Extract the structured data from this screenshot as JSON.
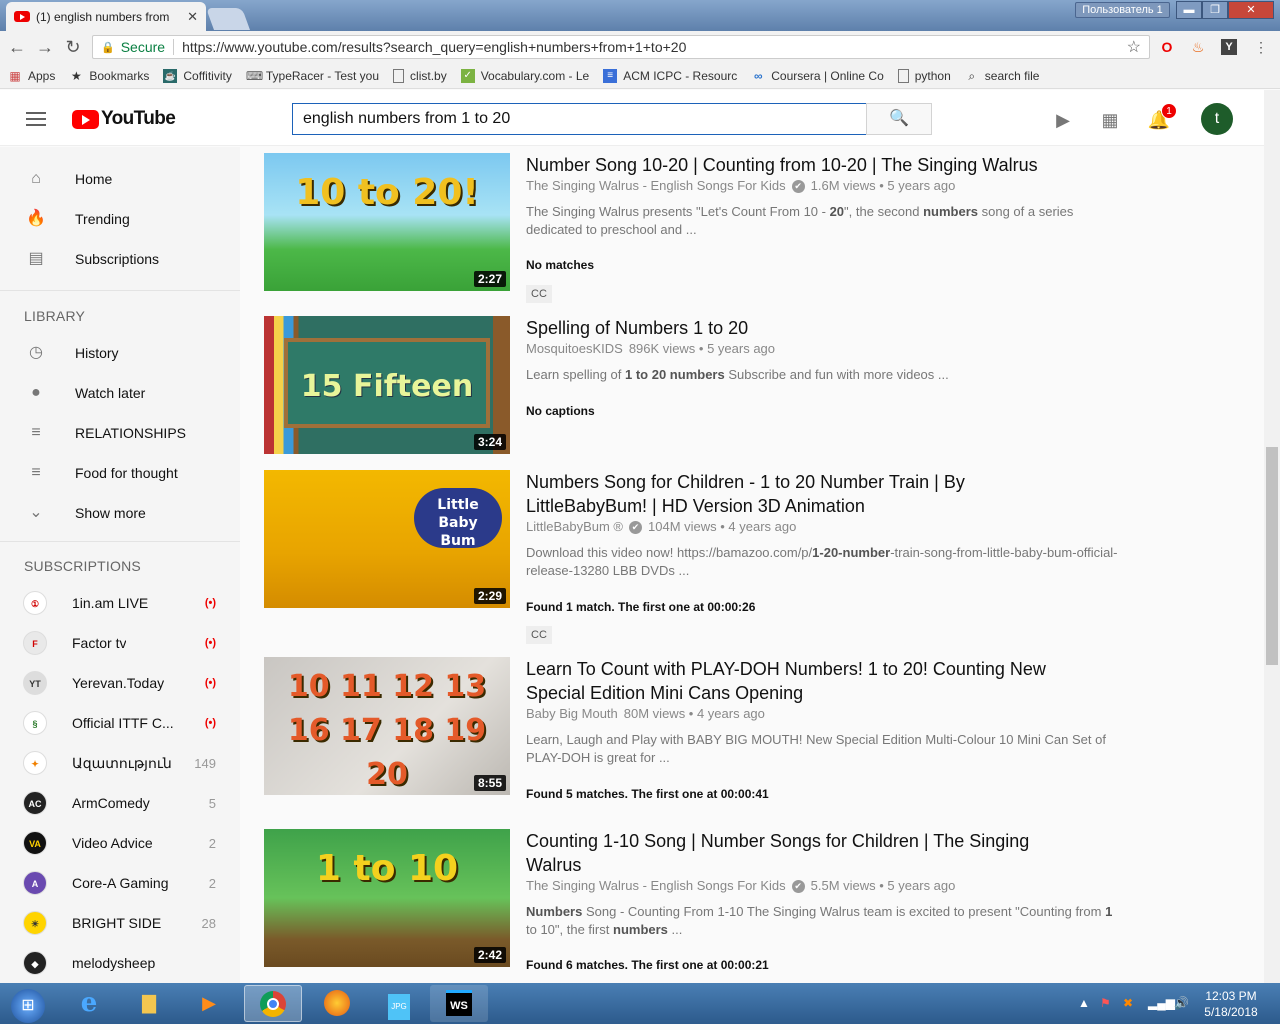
{
  "browser": {
    "tab_title": "(1) english numbers from",
    "tab_close": "✕",
    "user_chip": "Пользователь 1",
    "min": "▬",
    "max": "❐",
    "close": "✕",
    "secure_label": "Secure",
    "url": "https://www.youtube.com/results?search_query=english+numbers+from+1+to+20",
    "bookmarks": [
      {
        "label": "Apps",
        "icon": "apps-grid-icon"
      },
      {
        "label": "Bookmarks",
        "icon": "star-icon"
      },
      {
        "label": "Coffitivity",
        "icon": "coffee-icon"
      },
      {
        "label": "TypeRacer - Test you",
        "icon": "typeracer-icon"
      },
      {
        "label": "clist.by",
        "icon": "page-icon"
      },
      {
        "label": "Vocabulary.com - Le",
        "icon": "check-icon"
      },
      {
        "label": "ACM ICPC - Resourc",
        "icon": "doc-icon"
      },
      {
        "label": "Coursera | Online Co",
        "icon": "coursera-icon"
      },
      {
        "label": "python",
        "icon": "page-icon"
      },
      {
        "label": "search file",
        "icon": "search-file-icon"
      }
    ]
  },
  "youtube": {
    "logo_text": "YouTube",
    "search_value": "english numbers from 1 to 20",
    "notification_count": "1",
    "avatar_letter": "t"
  },
  "sidebar": {
    "main": [
      {
        "label": "Home",
        "icon": "home-icon"
      },
      {
        "label": "Trending",
        "icon": "flame-icon"
      },
      {
        "label": "Subscriptions",
        "icon": "subscriptions-icon"
      }
    ],
    "library_heading": "LIBRARY",
    "library": [
      {
        "label": "History",
        "icon": "history-icon"
      },
      {
        "label": "Watch later",
        "icon": "clock-icon"
      },
      {
        "label": "RELATIONSHIPS",
        "icon": "playlist-icon"
      },
      {
        "label": "Food for thought",
        "icon": "playlist-icon"
      },
      {
        "label": "Show more",
        "icon": "chevron-down-icon"
      }
    ],
    "subscriptions_heading": "SUBSCRIPTIONS",
    "subscriptions": [
      {
        "name": "1in.am LIVE",
        "badge": "(•)",
        "color": "#ffffff",
        "fg": "#d00000",
        "mono": "①"
      },
      {
        "name": "Factor tv",
        "badge": "(•)",
        "color": "#e9e9e9",
        "fg": "#d00000",
        "mono": "F"
      },
      {
        "name": "Yerevan.Today",
        "badge": "(•)",
        "color": "#dddddd",
        "fg": "#333333",
        "mono": "YT"
      },
      {
        "name": "Official ITTF C...",
        "badge": "(•)",
        "color": "#ffffff",
        "fg": "#2a7a2a",
        "mono": "§"
      },
      {
        "name": "Ազատություն",
        "badge": "149",
        "color": "#ffffff",
        "fg": "#f08000",
        "mono": "✦"
      },
      {
        "name": "ArmComedy",
        "badge": "5",
        "color": "#222222",
        "fg": "#ffffff",
        "mono": "AC"
      },
      {
        "name": "Video Advice",
        "badge": "2",
        "color": "#111111",
        "fg": "#ffd000",
        "mono": "VA"
      },
      {
        "name": "Core-A Gaming",
        "badge": "2",
        "color": "#6a4ab0",
        "fg": "#ffffff",
        "mono": "A"
      },
      {
        "name": "BRIGHT SIDE",
        "badge": "28",
        "color": "#ffd400",
        "fg": "#333333",
        "mono": "☀"
      },
      {
        "name": "melodysheep",
        "badge": "",
        "color": "#222222",
        "fg": "#ffffff",
        "mono": "◆"
      }
    ]
  },
  "results": [
    {
      "title": "Number Song 10-20 | Counting from 10-20 | The Singing Walrus",
      "channel": "The Singing Walrus - English Songs For Kids",
      "verified": "✔",
      "meta": "1.6M views • 5 years ago",
      "desc_parts": [
        "The Singing Walrus presents \"Let's Count From 10 - ",
        "20",
        "\", the second ",
        "numbers",
        " song of a series dedicated to preschool and ..."
      ],
      "match": "No matches",
      "cc": "CC",
      "duration": "2:27",
      "thumb_text": "10 to 20!"
    },
    {
      "title": "Spelling of Numbers 1 to 20",
      "channel": "MosquitoesKIDS",
      "verified": "",
      "meta": "896K views • 5 years ago",
      "desc_parts": [
        "Learn spelling of ",
        "1 to 20 numbers",
        " Subscribe and fun with more videos ..."
      ],
      "match": "No captions",
      "cc": "",
      "duration": "3:24",
      "thumb_text": "15 Fifteen"
    },
    {
      "title": "Numbers Song for Children - 1 to 20 Number Train | By LittleBabyBum! | HD Version 3D Animation",
      "channel": "LittleBabyBum ®",
      "verified": "✔",
      "meta": "104M views • 4 years ago",
      "desc_parts": [
        "Download this video now! https://bamazoo.com/p/",
        "1-20-number",
        "-train-song-from-little-baby-bum-official-release-13280 LBB DVDs ..."
      ],
      "match": "Found 1 match. The first one at 00:00:26",
      "cc": "CC",
      "duration": "2:29",
      "thumb_text": "Little Baby Bum"
    },
    {
      "title": "Learn To Count with PLAY-DOH Numbers! 1 to 20! Counting New Special Edition Mini Cans Opening",
      "channel": "Baby Big Mouth",
      "verified": "",
      "meta": "80M views • 4 years ago",
      "desc_parts": [
        "Learn, Laugh and Play with BABY BIG MOUTH! New Special Edition Multi-Colour 10 Mini Can Set of PLAY-DOH is great for ..."
      ],
      "match": "Found 5 matches. The first one at 00:00:41",
      "cc": "",
      "duration": "8:55",
      "thumb_text": "10 11 12 13 16 17 18 19 20"
    },
    {
      "title": "Counting 1-10 Song | Number Songs for Children | The Singing Walrus",
      "channel": "The Singing Walrus - English Songs For Kids",
      "verified": "✔",
      "meta": "5.5M views • 5 years ago",
      "desc_parts": [
        "Numbers",
        " Song - Counting From 1-10 The Singing Walrus team is excited to present \"Counting from ",
        "1",
        " to 10\", the first ",
        "numbers",
        " ..."
      ],
      "match": "Found 6 matches. The first one at 00:00:21",
      "cc": "",
      "duration": "2:42",
      "thumb_text": "1 to 10"
    }
  ],
  "taskbar": {
    "time": "12:03 PM",
    "date": "5/18/2018",
    "apps": [
      "start-orb",
      "internet-explorer",
      "file-explorer",
      "media-player",
      "chrome",
      "firefox",
      "jpg-viewer",
      "webstorm"
    ]
  }
}
